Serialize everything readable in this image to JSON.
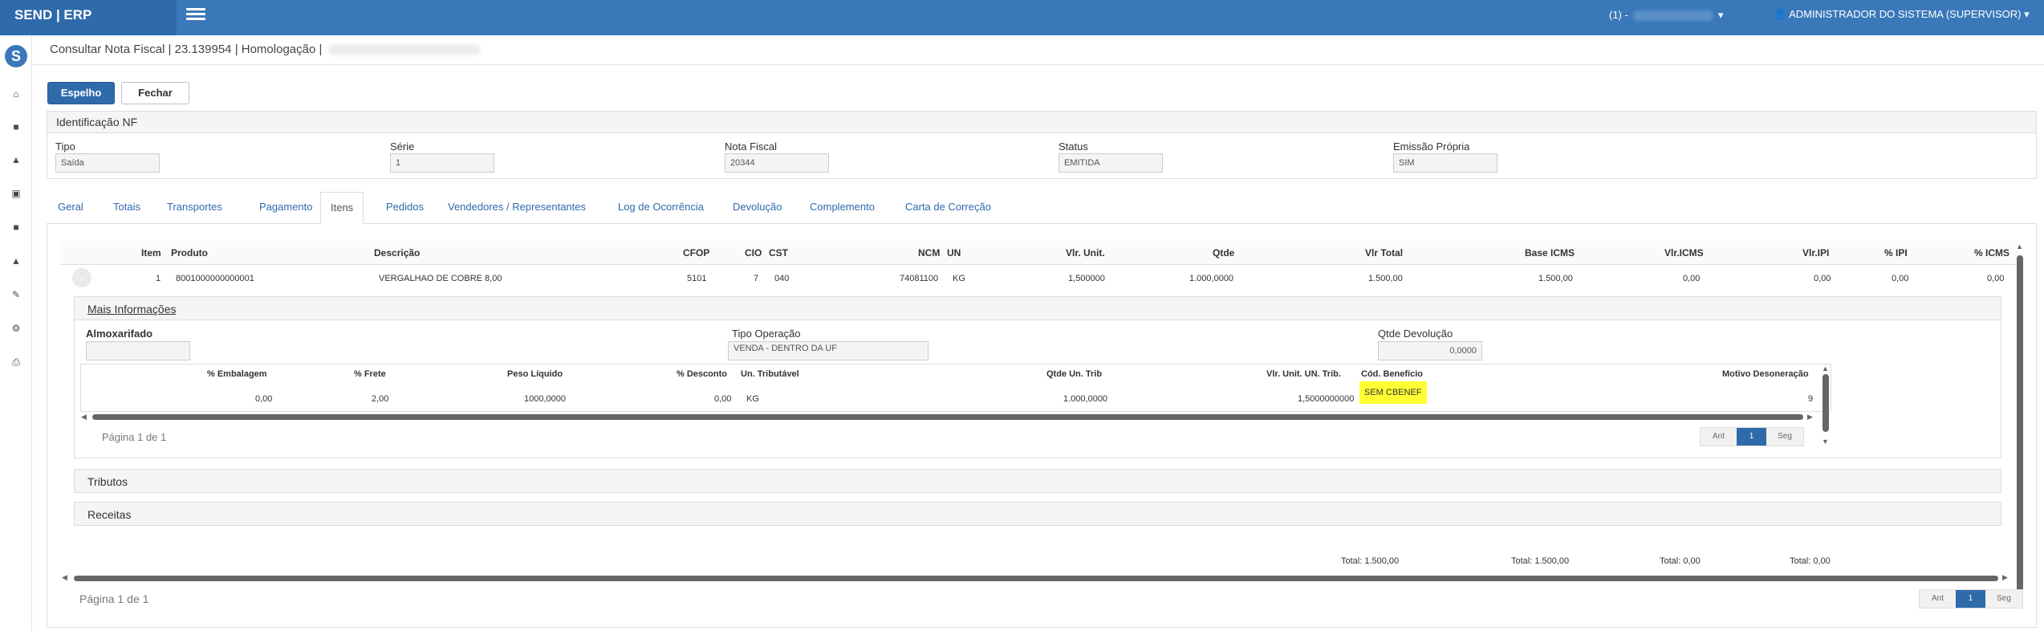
{
  "header": {
    "brand": "SEND | ERP",
    "context_prefix": "(1) -",
    "user": "ADMINISTRADOR DO SISTEMA (SUPERVISOR)"
  },
  "page": {
    "title": "Consultar Nota Fiscal | 23.139954 | Homologação |"
  },
  "toolbar": {
    "mirror": "Espelho",
    "close": "Fechar"
  },
  "identificacao": {
    "title": "Identificação NF",
    "tipo_label": "Tipo",
    "tipo": "Saída",
    "serie_label": "Série",
    "serie": "1",
    "nota_label": "Nota Fiscal",
    "nota": "20344",
    "status_label": "Status",
    "status": "EMITIDA",
    "emissao_label": "Emissão Própria",
    "emissao": "SIM"
  },
  "tabs": [
    "Geral",
    "Totais",
    "Transportes",
    "Pagamento",
    "Itens",
    "Pedidos",
    "Vendedores / Representantes",
    "Log de Ocorrência",
    "Devolução",
    "Complemento",
    "Carta de Correção"
  ],
  "items_table": {
    "headers": {
      "item": "Item",
      "produto": "Produto",
      "descricao": "Descrição",
      "cfop": "CFOP",
      "cio": "CIO",
      "cst": "CST",
      "ncm": "NCM",
      "un": "UN",
      "vlr_unit": "Vlr. Unit.",
      "qtde": "Qtde",
      "vlr_total": "Vlr Total",
      "base_icms": "Base ICMS",
      "vlr_icms": "Vlr.ICMS",
      "vlr_ipi": "Vlr.IPI",
      "pct_ipi": "% IPI",
      "pct_icms": "% ICMS"
    },
    "row": {
      "item": "1",
      "produto": "8001000000000001",
      "descricao": "VERGALHAO DE COBRE 8,00",
      "cfop": "5101",
      "cio": "7",
      "cst": "040",
      "ncm": "74081100",
      "un": "KG",
      "vlr_unit": "1,500000",
      "qtde": "1.000,0000",
      "vlr_total": "1.500,00",
      "base_icms": "1.500,00",
      "vlr_icms": "0,00",
      "vlr_ipi": "0,00",
      "pct_ipi": "0,00",
      "pct_icms": "0,00"
    }
  },
  "mais": {
    "title": "Mais Informações",
    "almox_label": "Almoxarifado",
    "almox": "",
    "tipo_op_label": "Tipo Operação",
    "tipo_op": "VENDA - DENTRO DA UF",
    "qtde_dev_label": "Qtde Devolução",
    "qtde_dev": "0,0000",
    "headers": {
      "embalagem": "% Embalagem",
      "frete": "% Frete",
      "peso": "Peso Líquido",
      "desconto": "% Desconto",
      "un_trib": "Un. Tributável",
      "qtde_trib": "Qtde Un. Trib",
      "vlr_trib": "Vlr. Unit. UN. Trib.",
      "cod_benef": "Cód. Benefício",
      "motivo": "Motivo Desoneração"
    },
    "row": {
      "embalagem": "0,00",
      "frete": "2,00",
      "peso": "1000,0000",
      "desconto": "0,00",
      "un_trib": "KG",
      "qtde_trib": "1.000,0000",
      "vlr_trib": "1,5000000000",
      "cod_benef": "SEM CBENEF",
      "motivo": "9"
    },
    "page_info": "Página 1 de 1"
  },
  "sections": {
    "tributos": "Tributos",
    "receitas": "Receitas"
  },
  "totals": {
    "t1": "Total: 1.500,00",
    "t2": "Total: 1.500,00",
    "t3": "Total: 0,00",
    "t4": "Total: 0,00"
  },
  "pager": {
    "prev": "Ant",
    "current": "1",
    "next": "Seg",
    "page_info": "Página 1 de 1"
  },
  "colors": {
    "brand": "#3a78ba",
    "highlight": "#ffff33"
  }
}
